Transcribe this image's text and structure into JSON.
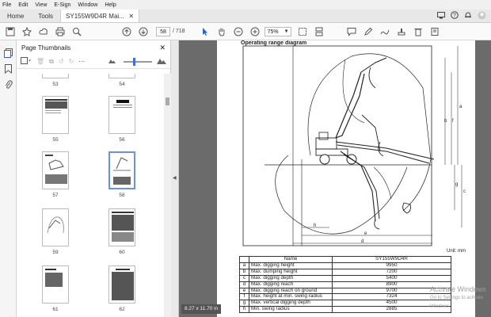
{
  "menu": [
    "File",
    "Edit",
    "View",
    "E-Sign",
    "Window",
    "Help"
  ],
  "tabs": {
    "home": "Home",
    "tools": "Tools",
    "doc": "SY155W9D4R Mai..."
  },
  "toolbar": {
    "page_current": "58",
    "page_total": "/ 718",
    "zoom": "75%"
  },
  "panel": {
    "title": "Page Thumbnails"
  },
  "thumbnails": [
    {
      "label": "53"
    },
    {
      "label": "54"
    },
    {
      "label": "55"
    },
    {
      "label": "56"
    },
    {
      "label": "57"
    },
    {
      "label": "58"
    },
    {
      "label": "59"
    },
    {
      "label": "60"
    },
    {
      "label": "61"
    },
    {
      "label": "62"
    }
  ],
  "page": {
    "heading": "Operating range diagram",
    "unit": "Unit: mm",
    "table_header": {
      "col1": "Name",
      "col2": "SY155W9D4R"
    },
    "rows": [
      {
        "k": "a",
        "name": "Max. digging height",
        "v": "9950"
      },
      {
        "k": "b",
        "name": "Max. dumping height",
        "v": "7200"
      },
      {
        "k": "c",
        "name": "Max. digging depth",
        "v": "5400"
      },
      {
        "k": "d",
        "name": "Max. digging reach",
        "v": "8900"
      },
      {
        "k": "e",
        "name": "Max. digging reach on ground",
        "v": "9700"
      },
      {
        "k": "f",
        "name": "Max. height at min. swing radius",
        "v": "7324"
      },
      {
        "k": "g",
        "name": "Max. vertical digging depth",
        "v": "4500"
      },
      {
        "k": "h",
        "name": "Min. swing radius",
        "v": "2885"
      }
    ],
    "dim_labels": [
      "a",
      "b",
      "c",
      "d",
      "e",
      "f",
      "g",
      "h"
    ]
  },
  "status": {
    "page_size": "8.27 x 11.70 in"
  },
  "watermark": {
    "line1": "Activate Windows",
    "line2": "Go to Settings to activate Windows."
  }
}
